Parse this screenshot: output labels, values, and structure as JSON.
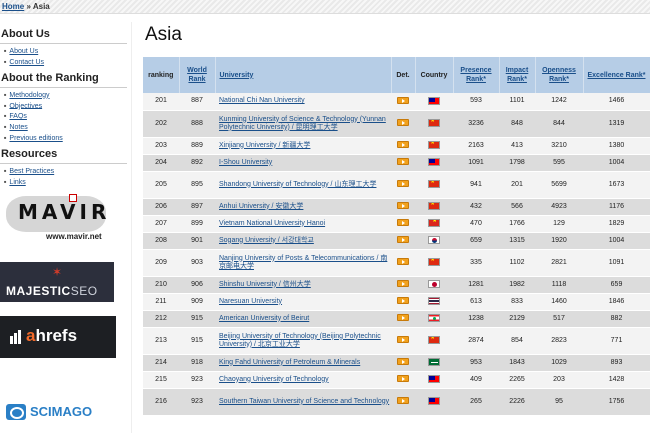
{
  "breadcrumb": {
    "home": "Home",
    "separator": "»",
    "current": "Asia"
  },
  "sidebar": {
    "about_heading": "About Us",
    "about_items": [
      "About Us",
      "Contact Us"
    ],
    "ranking_heading": "About the Ranking",
    "ranking_items": [
      "Methodology",
      "Objectives",
      "FAQs",
      "Notes",
      "Previous editions"
    ],
    "resources_heading": "Resources",
    "resources_items": [
      "Best Practices",
      "Links"
    ],
    "logos": {
      "mavir": {
        "name": "MAVIR",
        "url": "www.mavir.net"
      },
      "majestic": {
        "name": "MAJESTIC",
        "suffix": "SEO"
      },
      "ahrefs": {
        "name_a": "a",
        "name_rest": "hrefs"
      },
      "scimago": {
        "name": "SCIMAGO"
      }
    }
  },
  "page": {
    "title": "Asia"
  },
  "table": {
    "headers": {
      "ranking": "ranking",
      "world_rank": "World Rank",
      "university": "University",
      "det": "Det.",
      "country": "Country",
      "presence": "Presence Rank*",
      "impact": "Impact Rank*",
      "openness": "Openness Rank*",
      "excellence": "Excellence Rank*"
    },
    "rows": [
      {
        "ranking": "201",
        "world": "887",
        "university": "National Chi Nan University",
        "country": "tw",
        "presence": "593",
        "impact": "1101",
        "openness": "1242",
        "excellence": "1466"
      },
      {
        "ranking": "202",
        "world": "888",
        "university": "Kunming University of Science & Technology (Yunnan Polytechnic University) / 昆明理工大学",
        "country": "cn",
        "presence": "3236",
        "impact": "848",
        "openness": "844",
        "excellence": "1319"
      },
      {
        "ranking": "203",
        "world": "889",
        "university": "Xinjiang University / 新疆大学",
        "country": "cn",
        "presence": "2163",
        "impact": "413",
        "openness": "3210",
        "excellence": "1380"
      },
      {
        "ranking": "204",
        "world": "892",
        "university": "I-Shou University",
        "country": "tw",
        "presence": "1091",
        "impact": "1798",
        "openness": "595",
        "excellence": "1004"
      },
      {
        "ranking": "205",
        "world": "895",
        "university": "Shandong University of Technology / 山东理工大学",
        "country": "cn",
        "presence": "941",
        "impact": "201",
        "openness": "5699",
        "excellence": "1673"
      },
      {
        "ranking": "206",
        "world": "897",
        "university": "Anhui University / 安徽大学",
        "country": "cn",
        "presence": "432",
        "impact": "566",
        "openness": "4923",
        "excellence": "1176"
      },
      {
        "ranking": "207",
        "world": "899",
        "university": "Vietnam National University Hanoi",
        "country": "vn",
        "presence": "470",
        "impact": "1766",
        "openness": "129",
        "excellence": "1829"
      },
      {
        "ranking": "208",
        "world": "901",
        "university": "Sogang University / 서강대학교",
        "country": "kr",
        "presence": "659",
        "impact": "1315",
        "openness": "1920",
        "excellence": "1004"
      },
      {
        "ranking": "209",
        "world": "903",
        "university": "Nanjing University of Posts & Telecommunications / 南京邮电大学",
        "country": "cn",
        "presence": "335",
        "impact": "1102",
        "openness": "2821",
        "excellence": "1091"
      },
      {
        "ranking": "210",
        "world": "906",
        "university": "Shinshu University / 信州大学",
        "country": "jp",
        "presence": "1281",
        "impact": "1982",
        "openness": "1118",
        "excellence": "659"
      },
      {
        "ranking": "211",
        "world": "909",
        "university": "Naresuan University",
        "country": "th",
        "presence": "613",
        "impact": "833",
        "openness": "1460",
        "excellence": "1846"
      },
      {
        "ranking": "212",
        "world": "915",
        "university": "American University of Beirut",
        "country": "lb",
        "presence": "1238",
        "impact": "2129",
        "openness": "517",
        "excellence": "882"
      },
      {
        "ranking": "213",
        "world": "915",
        "university": "Beijing University of Technology (Beijing Polytechnic University) / 北京工业大学",
        "country": "cn",
        "presence": "2874",
        "impact": "854",
        "openness": "2823",
        "excellence": "771"
      },
      {
        "ranking": "214",
        "world": "918",
        "university": "King Fahd University of Petroleum & Minerals",
        "country": "sa",
        "presence": "953",
        "impact": "1843",
        "openness": "1029",
        "excellence": "893"
      },
      {
        "ranking": "215",
        "world": "923",
        "university": "Chaoyang University of Technology",
        "country": "tw",
        "presence": "409",
        "impact": "2265",
        "openness": "203",
        "excellence": "1428"
      },
      {
        "ranking": "216",
        "world": "923",
        "university": "Southern Taiwan University of Science and Technology",
        "country": "tw",
        "presence": "265",
        "impact": "2226",
        "openness": "95",
        "excellence": "1756"
      }
    ]
  }
}
